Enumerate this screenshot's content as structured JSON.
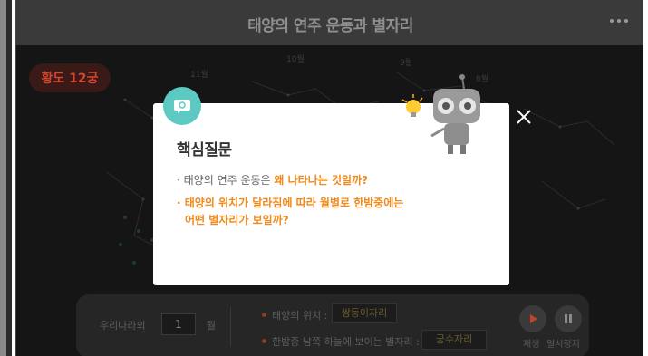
{
  "header": {
    "title": "태양의 연주 운동과 별자리",
    "more_icon": "more-horizontal-icon"
  },
  "zodiac_badge": {
    "label": "황도 12궁"
  },
  "sky": {
    "month_labels": [
      "11월",
      "10월",
      "9월",
      "8월"
    ]
  },
  "controls": {
    "country_label": "우리나라의",
    "month_value": "1",
    "month_unit": "월",
    "sun_position_label": "태양의 위치 :",
    "sun_position_value": "쌍둥이자리",
    "visible_constellation_label": "한밤중 남쪽 하늘에 보이는 별자리 :",
    "visible_constellation_value": "궁수자리",
    "play_label": "재생",
    "pause_label": "일시정지"
  },
  "modal": {
    "title": "핵심질문",
    "q1_prefix": "· 태양의 연주 운동은 ",
    "q1_highlight": "왜 나타나는 것일까?",
    "q2_line1": "· 태양의 위치가 달라짐에 따라 월별로 한밤중에는",
    "q2_line2": "어떤 별자리가 보일까?",
    "badge_icon": "speech-bubble-icon",
    "close_icon": "close-icon"
  },
  "colors": {
    "accent": "#f08a1c",
    "badge": "#5ec8c3",
    "zodiac": "#d4452f",
    "background": "#151515"
  }
}
